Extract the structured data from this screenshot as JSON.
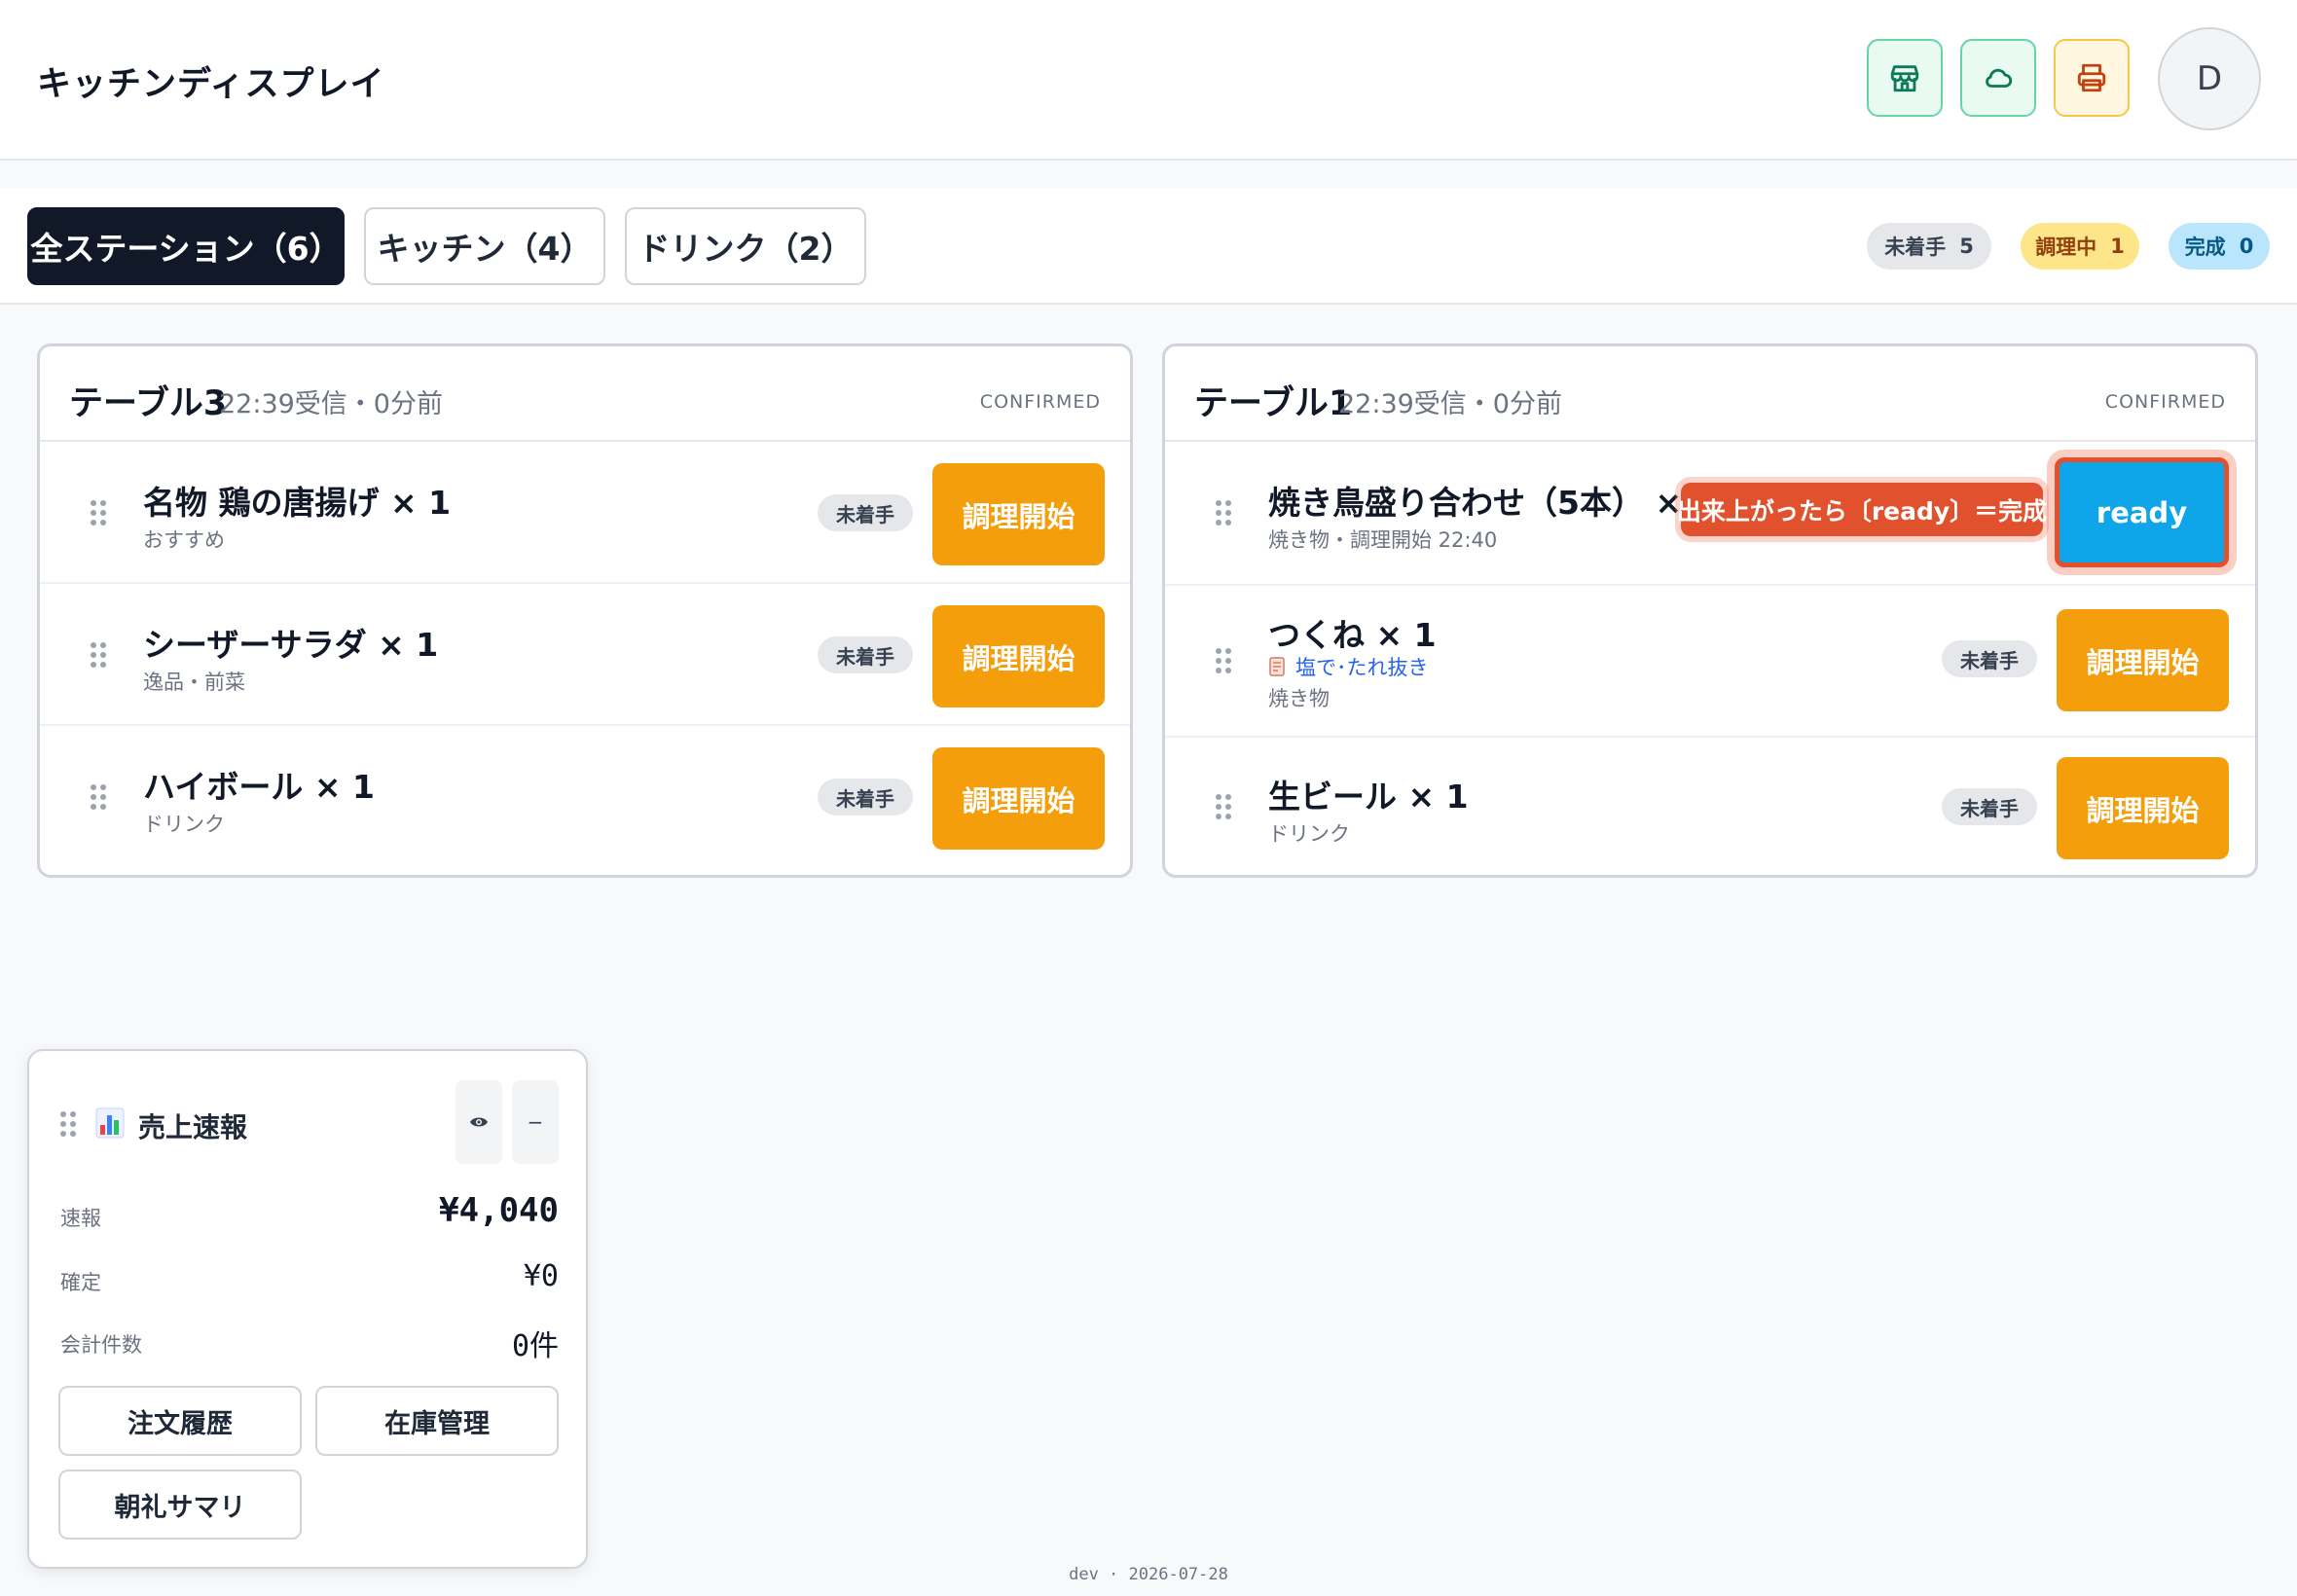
{
  "header": {
    "title": "キッチンディスプレイ",
    "store_icon": "store-icon",
    "cloud_icon": "cloud-icon",
    "printer_icon": "printer-icon",
    "avatar_initial": "D"
  },
  "stations": {
    "tabs": [
      {
        "label": "全ステーション（6）",
        "active": true
      },
      {
        "label": "キッチン（4）",
        "active": false
      },
      {
        "label": "ドリンク（2）",
        "active": false
      }
    ],
    "counts": [
      {
        "label": "未着手",
        "value": "5",
        "color": "#e5e7eb"
      },
      {
        "label": "調理中",
        "value": "1",
        "color": "#fde68a"
      },
      {
        "label": "完成",
        "value": "0",
        "color": "#bae6fd"
      }
    ]
  },
  "orders": [
    {
      "table": "テーブル3",
      "meta": "22:39受信・0分前",
      "status": "CONFIRMED",
      "items": [
        {
          "name": "名物 鶏の唐揚げ × 1",
          "sub": "おすすめ",
          "badge": "未着手",
          "action": "調理開始"
        },
        {
          "name": "シーザーサラダ × 1",
          "sub": "逸品・前菜",
          "badge": "未着手",
          "action": "調理開始"
        },
        {
          "name": "ハイボール × 1",
          "sub": "ドリンク",
          "badge": "未着手",
          "action": "調理開始"
        }
      ]
    },
    {
      "table": "テーブル1",
      "meta": "22:39受信・0分前",
      "status": "CONFIRMED",
      "items": [
        {
          "name": "焼き鳥盛り合わせ（5本） × 1",
          "sub": "焼き物・調理開始 22:40",
          "action": "ready",
          "hint": "出来上がったら〔ready〕＝完成"
        },
        {
          "name": "つくね × 1",
          "note": "塩で･たれ抜き",
          "sub": "焼き物",
          "badge": "未着手",
          "action": "調理開始"
        },
        {
          "name": "生ビール × 1",
          "sub": "ドリンク",
          "badge": "未着手",
          "action": "調理開始"
        }
      ]
    }
  ],
  "sales_widget": {
    "title": "売上速報",
    "icon": "bar-chart-icon",
    "eye_button": "eye-icon",
    "minimize_label": "−",
    "rows": [
      {
        "label": "速報",
        "value": "¥4,040"
      },
      {
        "label": "確定",
        "value": "¥0"
      },
      {
        "label": "会計件数",
        "value": "0件"
      }
    ],
    "buttons": [
      "注文履歴",
      "在庫管理",
      "朝礼サマリ"
    ]
  },
  "footer": "dev · 2026-07-28",
  "colors": {
    "accent_orange": "#f59e0b",
    "ready_blue": "#0ea5e9",
    "hint_red": "#e2512d",
    "active_tab": "#111827"
  }
}
